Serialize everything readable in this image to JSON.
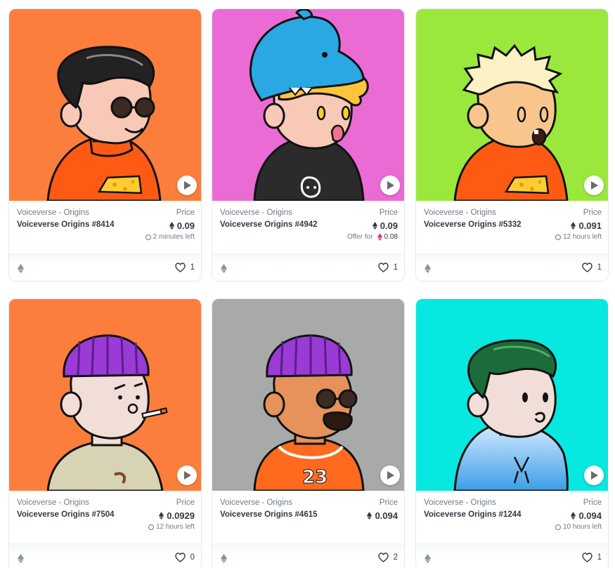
{
  "colors": {
    "card_border": "#e5e8eb",
    "text_primary": "#353840",
    "text_secondary": "#707a83",
    "offer_eth": "#e0348f"
  },
  "cards": [
    {
      "bg": "#fc7e3c",
      "collection": "Voiceverse - Origins",
      "name": "Voiceverse Origins #8414",
      "price_label": "Price",
      "price": "0.09",
      "sub_text": "2 minutes left",
      "sub_kind": "clock",
      "likes": "1"
    },
    {
      "bg": "#eb6bd5",
      "collection": "Voiceverse - Origins",
      "name": "Voiceverse Origins #4942",
      "price_label": "Price",
      "price": "0.09",
      "sub_text": "Offer for",
      "sub_value": "0.08",
      "sub_kind": "offer",
      "likes": "1"
    },
    {
      "bg": "#9be83c",
      "collection": "Voiceverse - Origins",
      "name": "Voiceverse Origins #5332",
      "price_label": "Price",
      "price": "0.091",
      "sub_text": "12 hours left",
      "sub_kind": "clock",
      "likes": "1"
    },
    {
      "bg": "#fc7e3c",
      "collection": "Voiceverse - Origins",
      "name": "Voiceverse Origins #7504",
      "price_label": "Price",
      "price": "0.0929",
      "sub_text": "12 hours left",
      "sub_kind": "clock",
      "likes": "0"
    },
    {
      "bg": "#a8a9a9",
      "collection": "Voiceverse - Origins",
      "name": "Voiceverse Origins #4615",
      "price_label": "Price",
      "price": "0.094",
      "sub_text": "",
      "sub_kind": "none",
      "likes": "2"
    },
    {
      "bg": "#06e8e0",
      "collection": "Voiceverse - Origins",
      "name": "Voiceverse Origins #1244",
      "price_label": "Price",
      "price": "0.094",
      "sub_text": "10 hours left",
      "sub_kind": "clock",
      "likes": "1"
    }
  ],
  "icons": {
    "play": "play-icon",
    "currency": "ethereum-icon",
    "chain": "ethereum-icon",
    "like": "heart-icon",
    "time": "clock-icon"
  }
}
